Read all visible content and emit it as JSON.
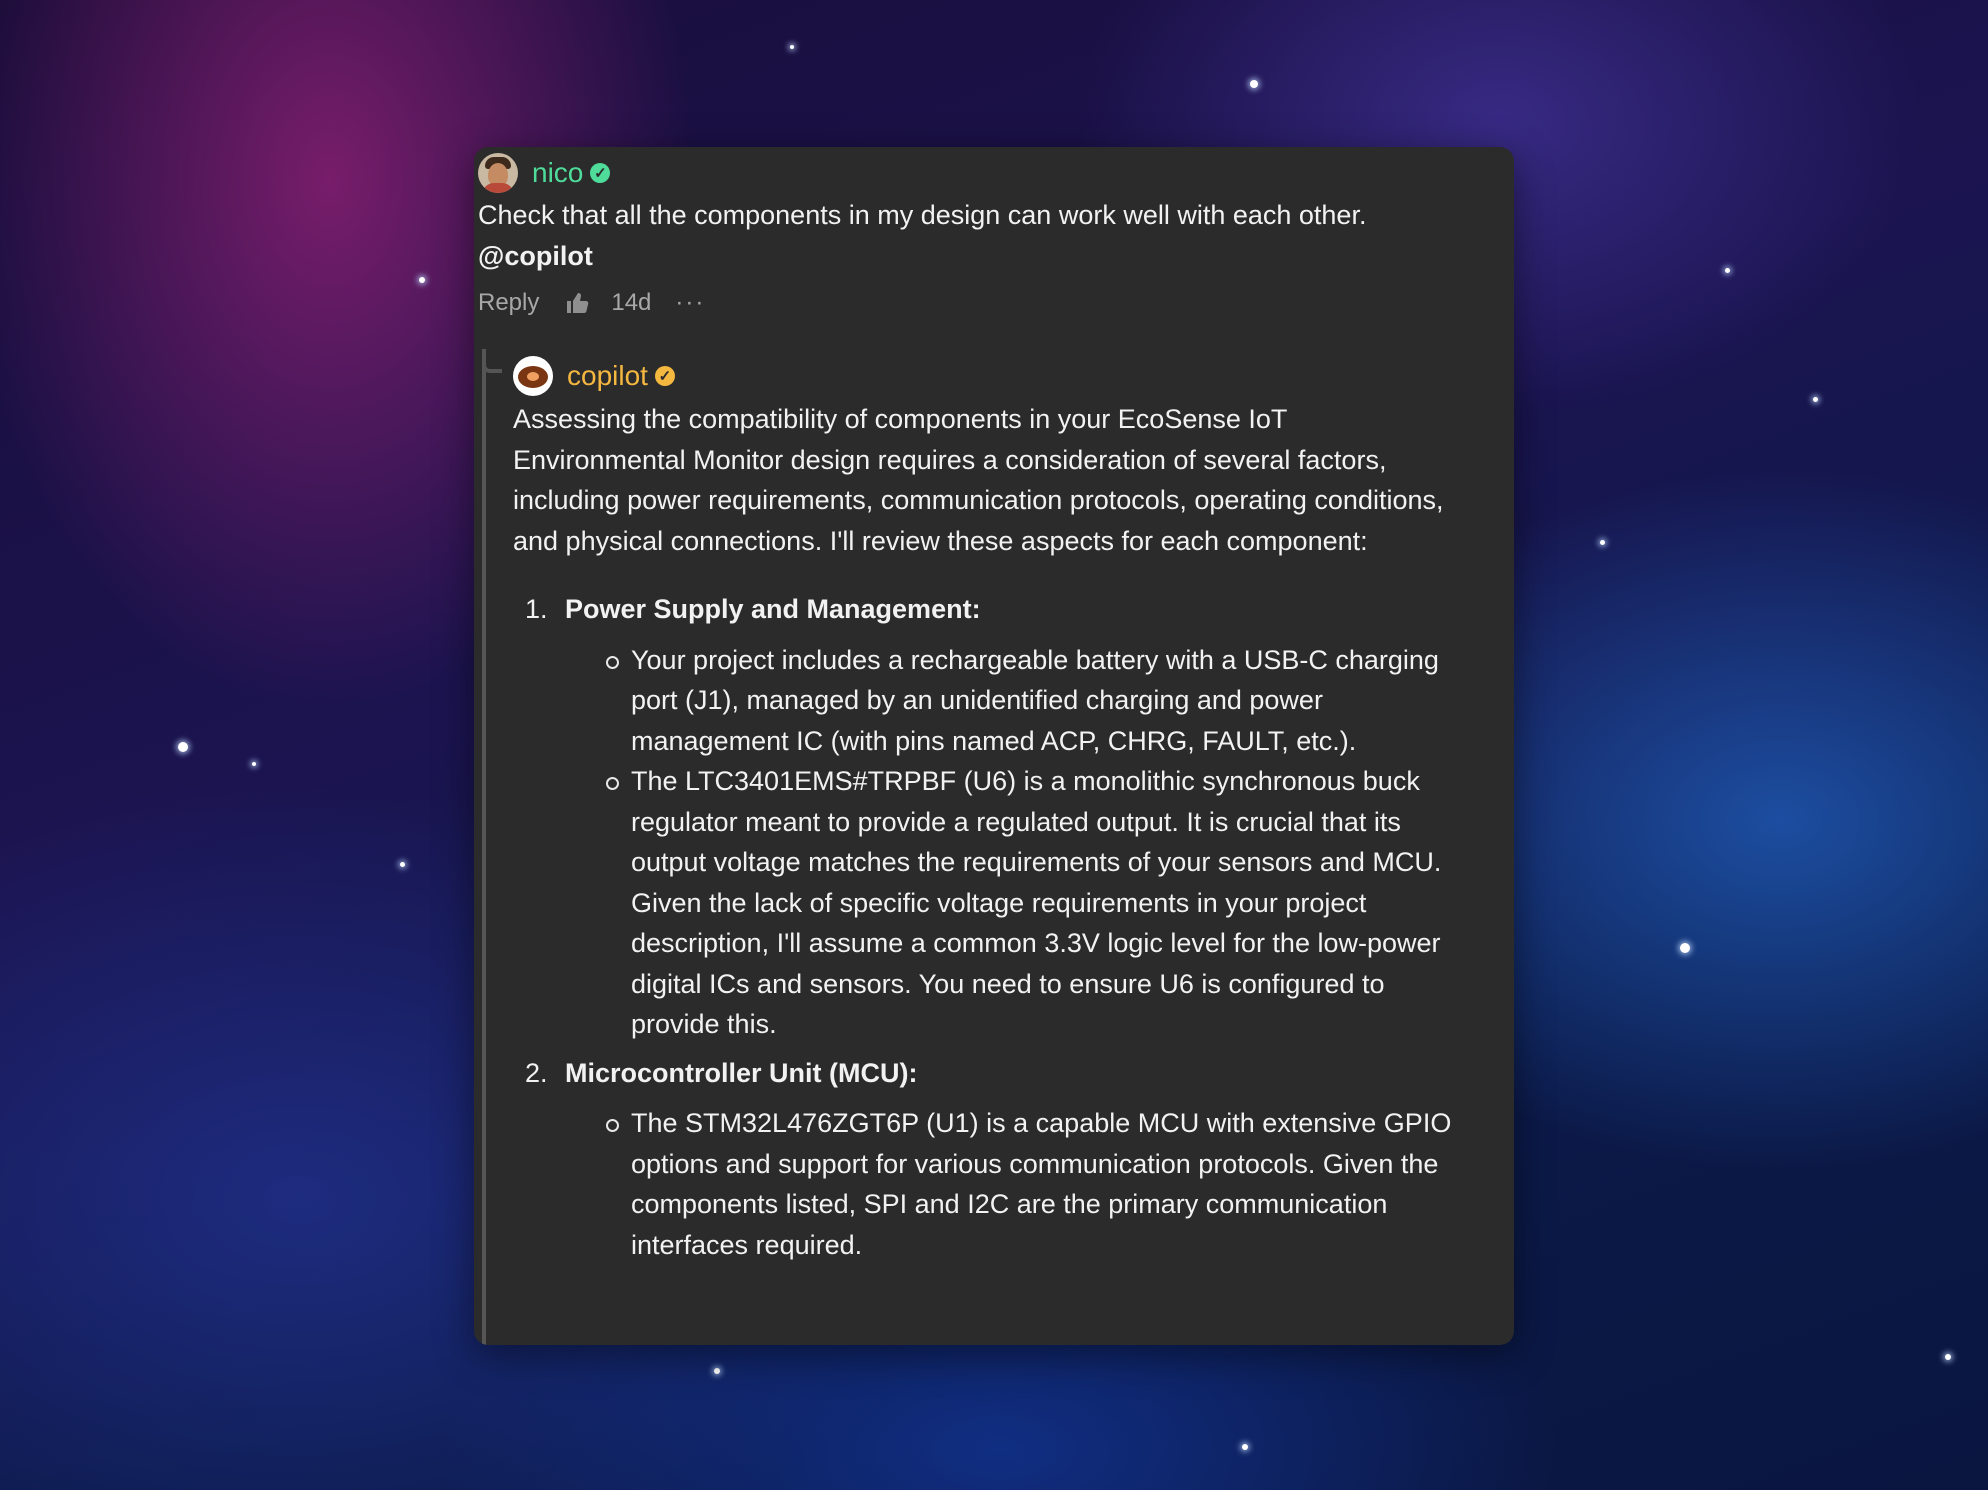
{
  "comment": {
    "author": "nico",
    "text": "Check that all the components in my design can work well with each other.",
    "mention": "@copilot",
    "reply_label": "Reply",
    "time": "14d",
    "more_label": "···"
  },
  "reply": {
    "author": "copilot",
    "intro": "Assessing the compatibility of components in your EcoSense IoT Environmental Monitor design requires a consideration of several factors, including power requirements, communication protocols, operating conditions, and physical connections. I'll review these aspects for each component:",
    "sections": [
      {
        "heading": "Power Supply and Management:",
        "items": [
          "Your project includes a rechargeable battery with a USB-C charging port (J1), managed by an unidentified charging and power management IC (with pins named ACP, CHRG, FAULT, etc.).",
          "The LTC3401EMS#TRPBF (U6) is a monolithic synchronous buck regulator meant to provide a regulated output. It is crucial that its output voltage matches the requirements of your sensors and MCU. Given the lack of specific voltage requirements in your project description, I'll assume a common 3.3V logic level for the low-power digital ICs and sensors. You need to ensure U6 is configured to provide this."
        ]
      },
      {
        "heading": "Microcontroller Unit (MCU):",
        "items": [
          "The STM32L476ZGT6P (U1) is a capable MCU with extensive GPIO options and support for various communication protocols. Given the components listed, SPI and I2C are the primary communication interfaces required."
        ]
      }
    ]
  },
  "colors": {
    "nico_name": "#4fdc9a",
    "copilot_name": "#f4b740",
    "card_bg": "#2b2b2b"
  },
  "icons": [
    "verified-badge-icon",
    "thumbs-up-icon",
    "more-options-icon"
  ]
}
